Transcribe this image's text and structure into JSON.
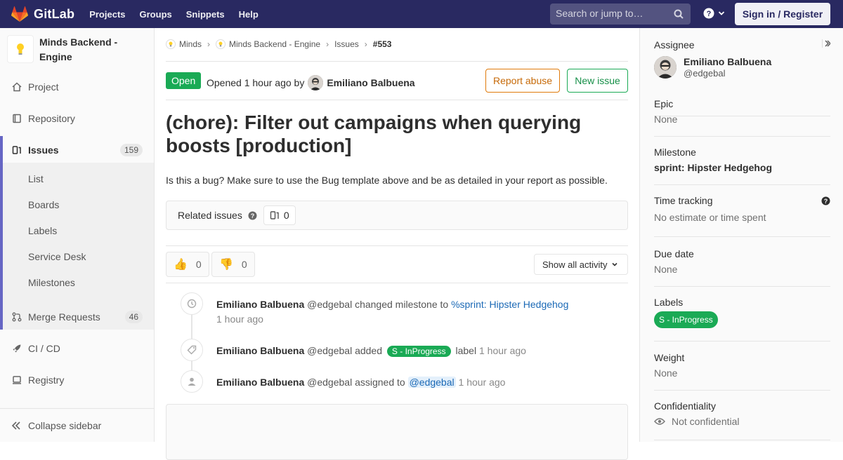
{
  "navbar": {
    "brand": "GitLab",
    "links": [
      "Projects",
      "Groups",
      "Snippets",
      "Help"
    ],
    "search_placeholder": "Search or jump to…",
    "signin": "Sign in / Register"
  },
  "project": {
    "name": "Minds Backend - Engine"
  },
  "sidebar": {
    "project": "Project",
    "repository": "Repository",
    "issues": "Issues",
    "issues_count": "159",
    "sub": [
      "List",
      "Boards",
      "Labels",
      "Service Desk",
      "Milestones"
    ],
    "merge_requests": "Merge Requests",
    "mr_count": "46",
    "cicd": "CI / CD",
    "registry": "Registry",
    "collapse": "Collapse sidebar"
  },
  "breadcrumbs": [
    "Minds",
    "Minds Backend - Engine",
    "Issues",
    "#553"
  ],
  "issue": {
    "status": "Open",
    "opened": "Opened 1 hour ago by",
    "author": "Emiliano Balbuena",
    "report_abuse": "Report abuse",
    "new_issue": "New issue",
    "title": "(chore): Filter out campaigns when querying boosts [production]",
    "description": "Is this a bug? Make sure to use the Bug template above and be as detailed in your report as possible.",
    "related_title": "Related issues",
    "related_count": "0",
    "thumbs_up": "0",
    "thumbs_down": "0",
    "activity_filter": "Show all activity"
  },
  "notes": [
    {
      "author": "Emiliano Balbuena",
      "handle": "@edgebal",
      "action": "changed milestone to",
      "target": "%sprint: Hipster Hedgehog",
      "time": "1 hour ago"
    },
    {
      "author": "Emiliano Balbuena",
      "handle": "@edgebal",
      "action": "added",
      "label": "S - InProgress",
      "suffix": "label",
      "time": "1 hour ago"
    },
    {
      "author": "Emiliano Balbuena",
      "handle": "@edgebal",
      "action": "assigned to",
      "target": "@edgebal",
      "time": "1 hour ago"
    }
  ],
  "right": {
    "assignee_title": "Assignee",
    "assignee_name": "Emiliano Balbuena",
    "assignee_handle": "@edgebal",
    "epic_title": "Epic",
    "epic_value": "None",
    "milestone_title": "Milestone",
    "milestone_value": "sprint: Hipster Hedgehog",
    "time_title": "Time tracking",
    "time_value": "No estimate or time spent",
    "due_title": "Due date",
    "due_value": "None",
    "labels_title": "Labels",
    "label_value": "S - InProgress",
    "weight_title": "Weight",
    "weight_value": "None",
    "conf_title": "Confidentiality",
    "conf_value": "Not confidential"
  },
  "colors": {
    "navbar": "#292961",
    "accent": "#6666c4",
    "success": "#1aaa55",
    "warning": "#e07a0a",
    "link": "#1b69b6"
  }
}
